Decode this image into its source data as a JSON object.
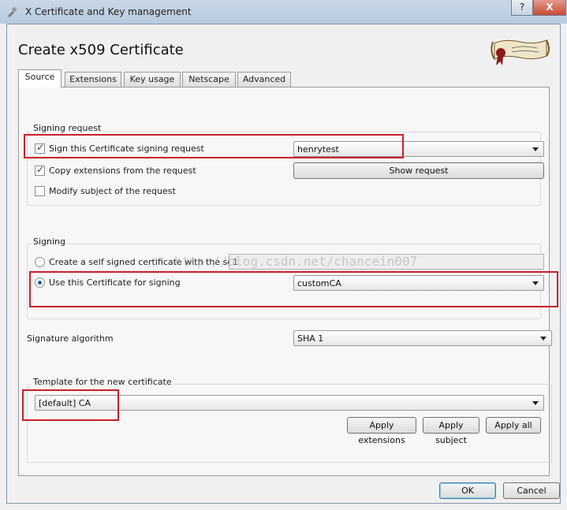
{
  "window": {
    "title": "X Certificate and Key management",
    "close_label": "X"
  },
  "dialog": {
    "heading": "Create x509 Certificate"
  },
  "tabs": [
    {
      "label": "Source",
      "active": true
    },
    {
      "label": "Extensions"
    },
    {
      "label": "Key usage"
    },
    {
      "label": "Netscape"
    },
    {
      "label": "Advanced"
    }
  ],
  "signing_request": {
    "group_title": "Signing request",
    "sign_csr": {
      "label": "Sign this Certificate signing request",
      "checked": true
    },
    "csr_select": {
      "value": "henrytest"
    },
    "copy_extensions": {
      "label": "Copy extensions from the request",
      "checked": true
    },
    "show_request_label": "Show request",
    "modify_subject": {
      "label": "Modify subject of the request",
      "checked": false
    }
  },
  "signing": {
    "group_title": "Signing",
    "self_signed": {
      "label": "Create a self signed certificate with the serial",
      "selected": false
    },
    "serial_value": "1",
    "use_ca": {
      "label": "Use this Certificate for signing",
      "selected": true
    },
    "ca_select": {
      "value": "customCA"
    }
  },
  "signature_algorithm": {
    "label": "Signature algorithm",
    "value": "SHA 1"
  },
  "template": {
    "group_title": "Template for the new certificate",
    "select_value": "[default] CA",
    "apply_extensions_label": "Apply extensions",
    "apply_subject_label": "Apply subject",
    "apply_all_label": "Apply all"
  },
  "footer": {
    "ok_label": "OK",
    "cancel_label": "Cancel"
  },
  "watermark": "http://blog.csdn.net/chancein007",
  "colors": {
    "highlight": "#c8202a",
    "titlebar": "#c9d7e7",
    "accent": "#2b5aa0"
  }
}
